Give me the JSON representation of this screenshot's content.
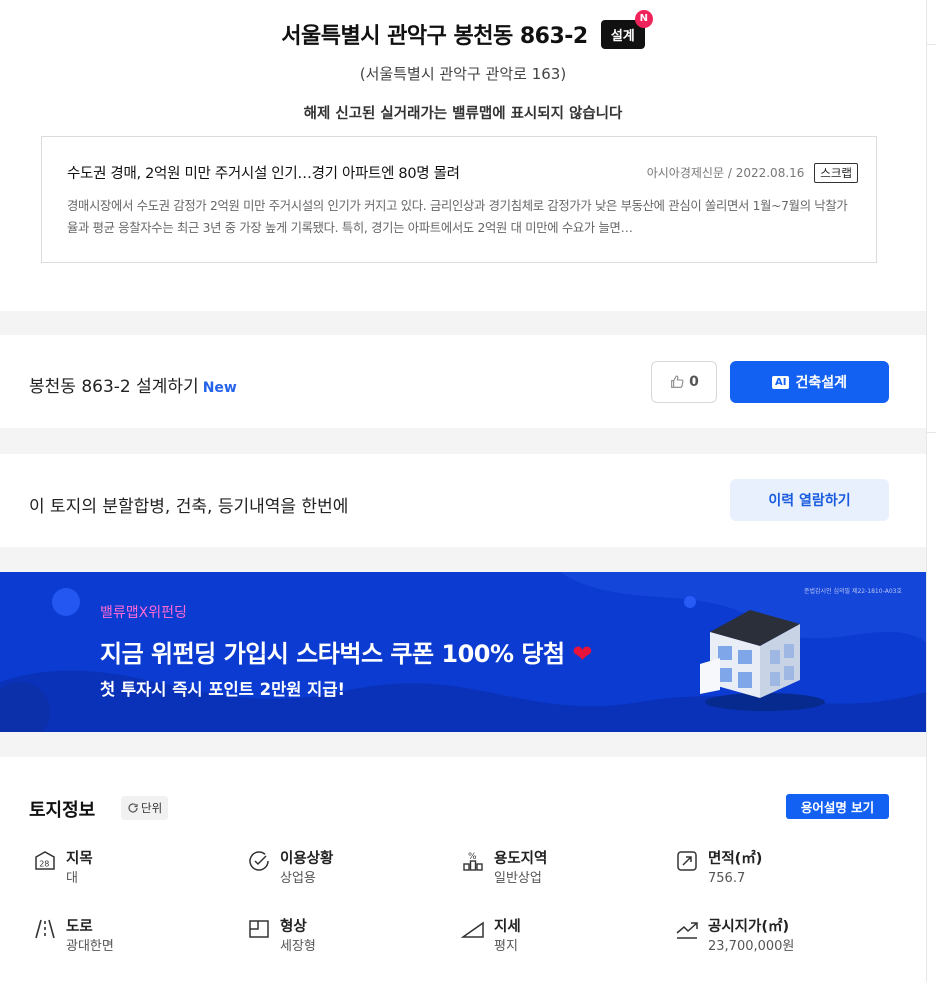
{
  "header": {
    "title": "서울특별시 관악구 봉천동 863-2",
    "design_badge": "설계",
    "new_badge": "N",
    "road_address": "(서울특별시 관악구 관악로 163)",
    "notice": "해제 신고된 실거래가는 밸류맵에 표시되지 않습니다"
  },
  "news": {
    "title": "수도권 경매, 2억원 미만 주거시설 인기…경기 아파트엔 80명 몰려",
    "source": "아시아경제신문",
    "separator": "/",
    "date": "2022.08.16",
    "scrap_label": "스크랩",
    "body": "경매시장에서 수도권 감정가 2억원 미만 주거시설의 인기가 커지고 있다. 금리인상과 경기침체로 감정가가 낮은 부동산에 관심이 쏠리면서 1월~7월의 낙찰가율과 평균 응찰자수는 최근 3년 중 가장 높게 기록됐다. 특히, 경기는 아파트에서도 2억원 대 미만에 수요가 늘면…"
  },
  "design": {
    "label": "봉천동 863-2 설계하기",
    "new_tag": "New",
    "like_count": "0",
    "ai_chip": "AI",
    "ai_button": "건축설계"
  },
  "history": {
    "label": "이 토지의 분할합병, 건축, 등기내역을 한번에",
    "button": "이력 열람하기"
  },
  "banner": {
    "small": "밸류맵X위펀딩",
    "headline": "지금 위펀딩 가입시 스타벅스 쿠폰 100% 당첨",
    "heart": "❤",
    "sub": "첫 투자시 즉시 포인트 2만원 지급!",
    "reg_no": "준법감시인 심의필 제22-1810-A03호"
  },
  "land": {
    "title": "토지정보",
    "unit_button": "단위",
    "glossary_button": "용어설명 보기",
    "items": [
      {
        "label": "지목",
        "value": "대",
        "icon": "land-category-icon"
      },
      {
        "label": "이용상황",
        "value": "상업용",
        "icon": "check-circle-icon"
      },
      {
        "label": "용도지역",
        "value": "일반상업",
        "icon": "zoning-icon"
      },
      {
        "label": "면적(㎡)",
        "value": "756.7",
        "icon": "area-icon"
      },
      {
        "label": "도로",
        "value": "광대한면",
        "icon": "road-icon"
      },
      {
        "label": "형상",
        "value": "세장형",
        "icon": "shape-icon"
      },
      {
        "label": "지세",
        "value": "평지",
        "icon": "terrain-icon"
      },
      {
        "label": "공시지가(㎡)",
        "value": "23,700,000원",
        "icon": "trend-up-icon"
      }
    ]
  },
  "colors": {
    "primary": "#1361f2",
    "banner_bg": "#0b3bd0",
    "badge_red": "#f0245a"
  }
}
